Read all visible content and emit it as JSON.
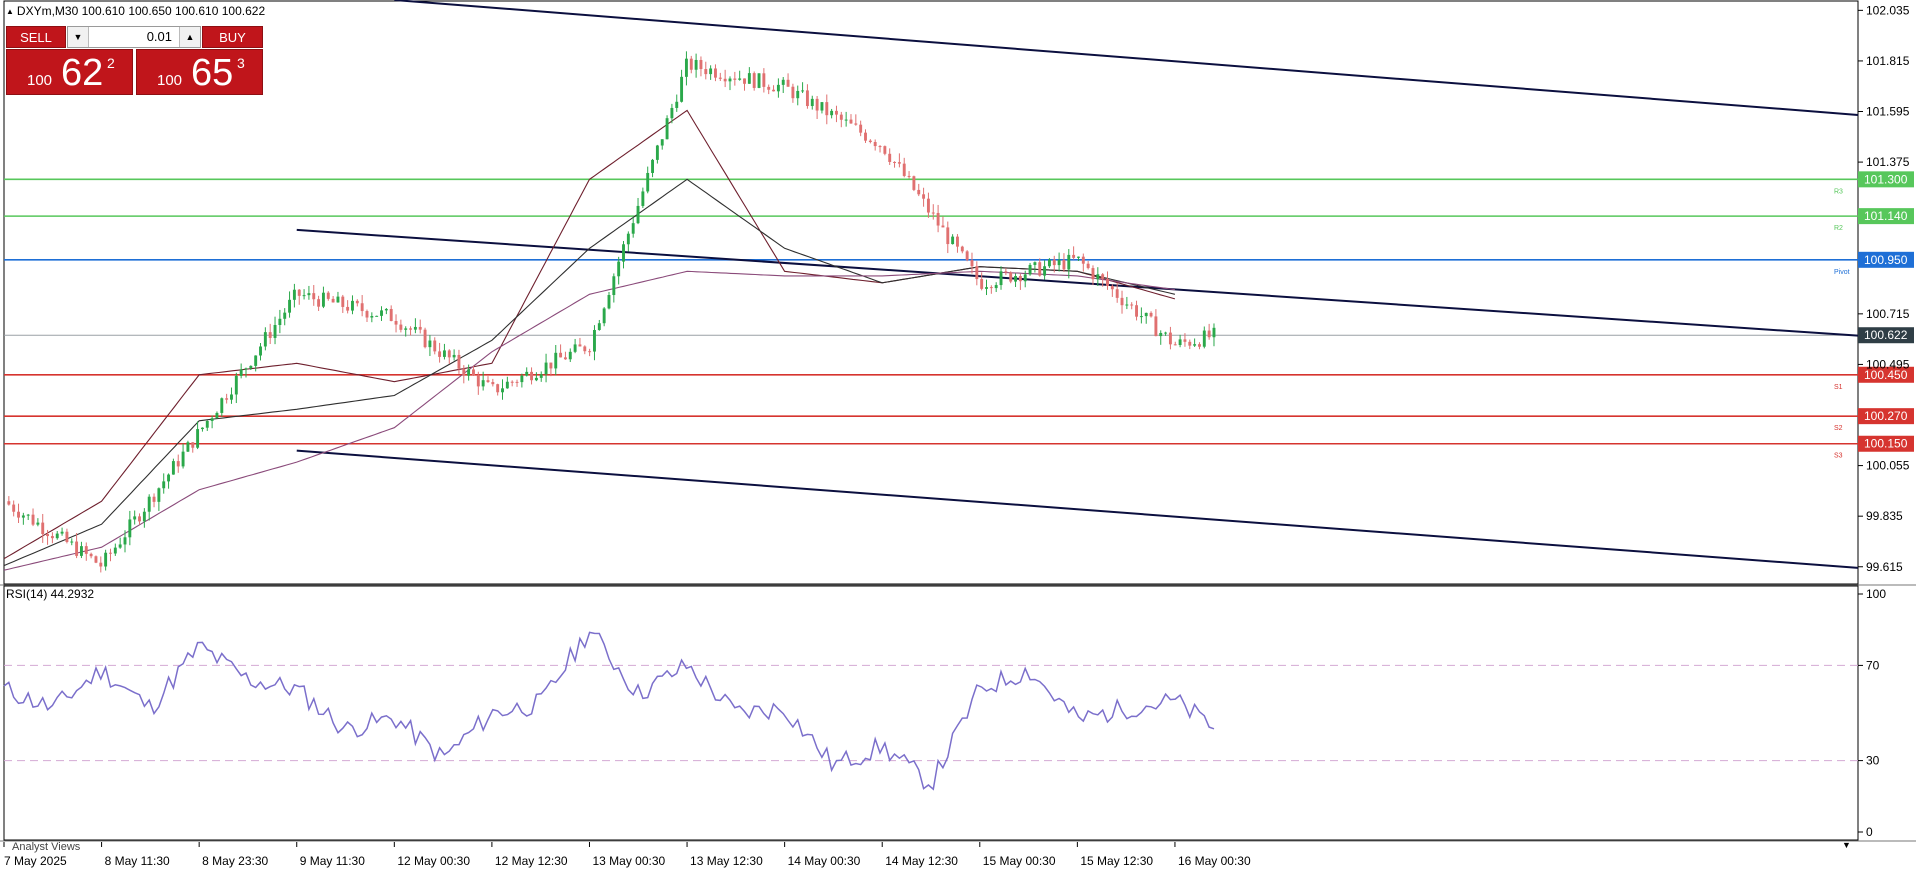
{
  "window": {
    "symbol_line": "DXYm,M30  100.610 100.650 100.610 100.622",
    "rsi_label": "RSI(14) 44.2932",
    "analyst_tab": "Analyst Views"
  },
  "trade_panel": {
    "sell_label": "SELL",
    "buy_label": "BUY",
    "lot": "0.01",
    "bid": {
      "small": "100",
      "big": "62",
      "sup": "2"
    },
    "ask": {
      "small": "100",
      "big": "65",
      "sup": "3"
    }
  },
  "colors": {
    "bull": "#2aa84a",
    "bear": "#e07070",
    "resistance": "#57c75b",
    "pivot": "#1e6fd6",
    "support": "#d6342f",
    "channel": "#0b0f3f",
    "rsi": "#7b6fcb",
    "rsi_level": "#d4a9d4",
    "ma_fast": "#6e1f2d",
    "ma_mid": "#2f2f2f",
    "ma_slow": "#8a4a7a",
    "current": "#2f3e46"
  },
  "chart_data": [
    {
      "type": "line",
      "subtype": "candlestick",
      "title": "DXYm,M30",
      "x_axis_labels": [
        "7 May 2025",
        "8 May 11:30",
        "8 May 23:30",
        "9 May 11:30",
        "12 May 00:30",
        "12 May 12:30",
        "13 May 00:30",
        "13 May 12:30",
        "14 May 00:30",
        "14 May 12:30",
        "15 May 00:30",
        "15 May 12:30",
        "16 May 00:30"
      ],
      "ylim": [
        99.54,
        102.08
      ],
      "y_ticks": [
        "102.035",
        "101.815",
        "101.595",
        "101.375",
        "100.715",
        "100.495",
        "100.055",
        "99.835",
        "99.615"
      ],
      "grid": false,
      "series": [
        {
          "name": "close",
          "x": [
            0,
            1,
            2,
            3,
            4,
            5,
            6,
            7,
            8,
            9,
            10,
            11,
            12,
            12.4
          ],
          "values": [
            99.9,
            99.62,
            100.2,
            100.8,
            100.7,
            100.38,
            100.58,
            101.8,
            101.7,
            101.45,
            100.85,
            100.95,
            100.58,
            100.62
          ]
        },
        {
          "name": "ma_fast",
          "x": [
            0,
            1,
            2,
            3,
            4,
            5,
            6,
            7,
            8,
            9,
            10,
            11,
            12
          ],
          "values": [
            99.65,
            99.9,
            100.45,
            100.5,
            100.42,
            100.5,
            101.3,
            101.6,
            100.9,
            100.85,
            100.92,
            100.9,
            100.78
          ]
        },
        {
          "name": "ma_mid",
          "x": [
            0,
            1,
            2,
            3,
            4,
            5,
            6,
            7,
            8,
            9,
            10,
            11,
            12
          ],
          "values": [
            99.62,
            99.8,
            100.25,
            100.3,
            100.36,
            100.6,
            101.0,
            101.3,
            101.0,
            100.85,
            100.92,
            100.9,
            100.8
          ]
        },
        {
          "name": "ma_slow",
          "x": [
            0,
            1,
            2,
            3,
            4,
            5,
            6,
            7,
            8,
            9,
            10,
            11,
            12
          ],
          "values": [
            99.6,
            99.7,
            99.95,
            100.07,
            100.22,
            100.55,
            100.8,
            100.9,
            100.88,
            100.88,
            100.9,
            100.88,
            100.82
          ]
        }
      ],
      "levels": [
        {
          "label": "R3",
          "value": 101.3,
          "price": "101.300",
          "kind": "resistance"
        },
        {
          "label": "R2",
          "value": 101.14,
          "price": "101.140",
          "kind": "resistance"
        },
        {
          "label": "Pivot",
          "value": 100.95,
          "price": "100.950",
          "kind": "pivot"
        },
        {
          "label": "S1",
          "value": 100.45,
          "price": "100.450",
          "kind": "support"
        },
        {
          "label": "S2",
          "value": 100.27,
          "price": "100.270",
          "kind": "support"
        },
        {
          "label": "S3",
          "value": 100.15,
          "price": "100.150",
          "kind": "support"
        }
      ],
      "current_price": {
        "value": 100.622,
        "price": "100.622"
      },
      "channel_lines": [
        {
          "x": [
            4.0,
            19.0
          ],
          "values": [
            102.08,
            101.58
          ]
        },
        {
          "x": [
            3.0,
            19.0
          ],
          "values": [
            101.08,
            100.62
          ]
        },
        {
          "x": [
            3.0,
            19.0
          ],
          "values": [
            100.12,
            99.61
          ]
        }
      ]
    },
    {
      "type": "line",
      "title": "RSI(14) 44.2932",
      "ylim": [
        0,
        100
      ],
      "y_ticks": [
        "100",
        "70",
        "30",
        "0"
      ],
      "levels": [
        70,
        30
      ],
      "x": [
        0,
        0.5,
        1,
        1.5,
        2,
        2.5,
        3,
        3.5,
        4,
        4.5,
        5,
        5.5,
        6,
        6.5,
        7,
        7.5,
        8,
        8.5,
        9,
        9.5,
        10,
        10.5,
        11,
        11.5,
        12,
        12.4
      ],
      "values": [
        60,
        52,
        68,
        52,
        78,
        64,
        60,
        43,
        48,
        31,
        50,
        54,
        85,
        58,
        70,
        50,
        52,
        28,
        36,
        20,
        60,
        68,
        47,
        52,
        55,
        44
      ]
    }
  ]
}
